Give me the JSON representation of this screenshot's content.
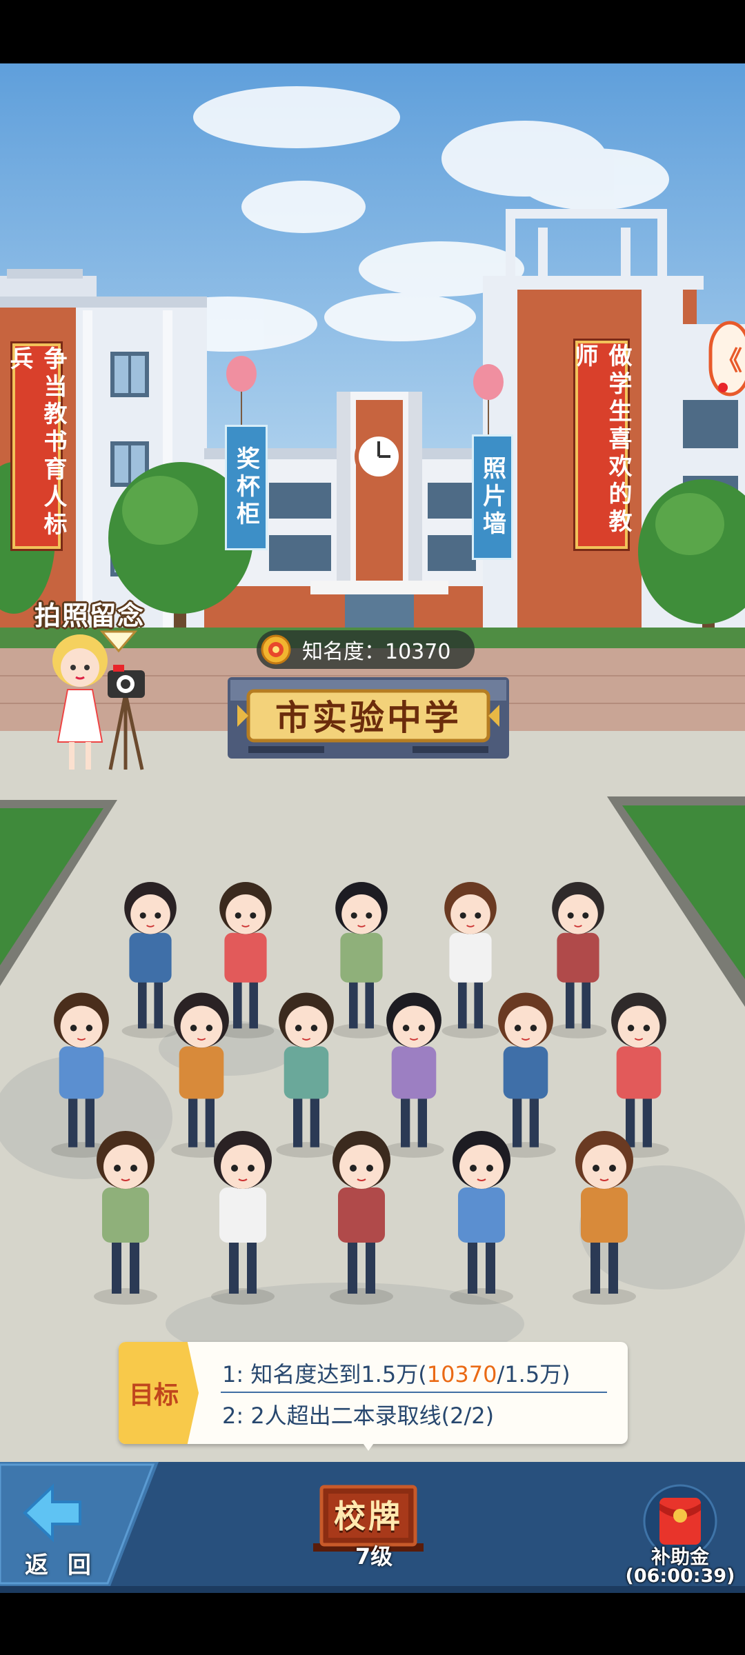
{
  "banners": {
    "left_red": "争当教书育人标兵",
    "right_red": "做学生喜欢的教师",
    "trophy_cabinet": "奖杯柜",
    "photo_wall": "照片墙"
  },
  "photo_spot": {
    "label": "拍照留念"
  },
  "fame": {
    "text": "知名度：10370"
  },
  "school": {
    "name": "市实验中学"
  },
  "goals": {
    "tag": "目标",
    "goal1": {
      "prefix": "1: 知名度达到1.5万(",
      "current": "10370",
      "suffix": "/1.5万)"
    },
    "goal2": "2: 2人超出二本录取线(2/2)"
  },
  "bottom_bar": {
    "back_label": "返 回",
    "plaque_label": "校牌",
    "plaque_level": "7级",
    "subsidy_label": "补助金",
    "subsidy_timer": "(06:00:39)"
  },
  "side_tab": {
    "arrow": "《"
  },
  "colors": {
    "sky": "#8fc3e8",
    "brick": "#c7643f",
    "banner_red": "#d9402b",
    "banner_blue": "#3d8fc7",
    "goal_tag": "#f8c94a",
    "goal_highlight": "#ea6a15",
    "bottom_bar": "#28507d"
  }
}
